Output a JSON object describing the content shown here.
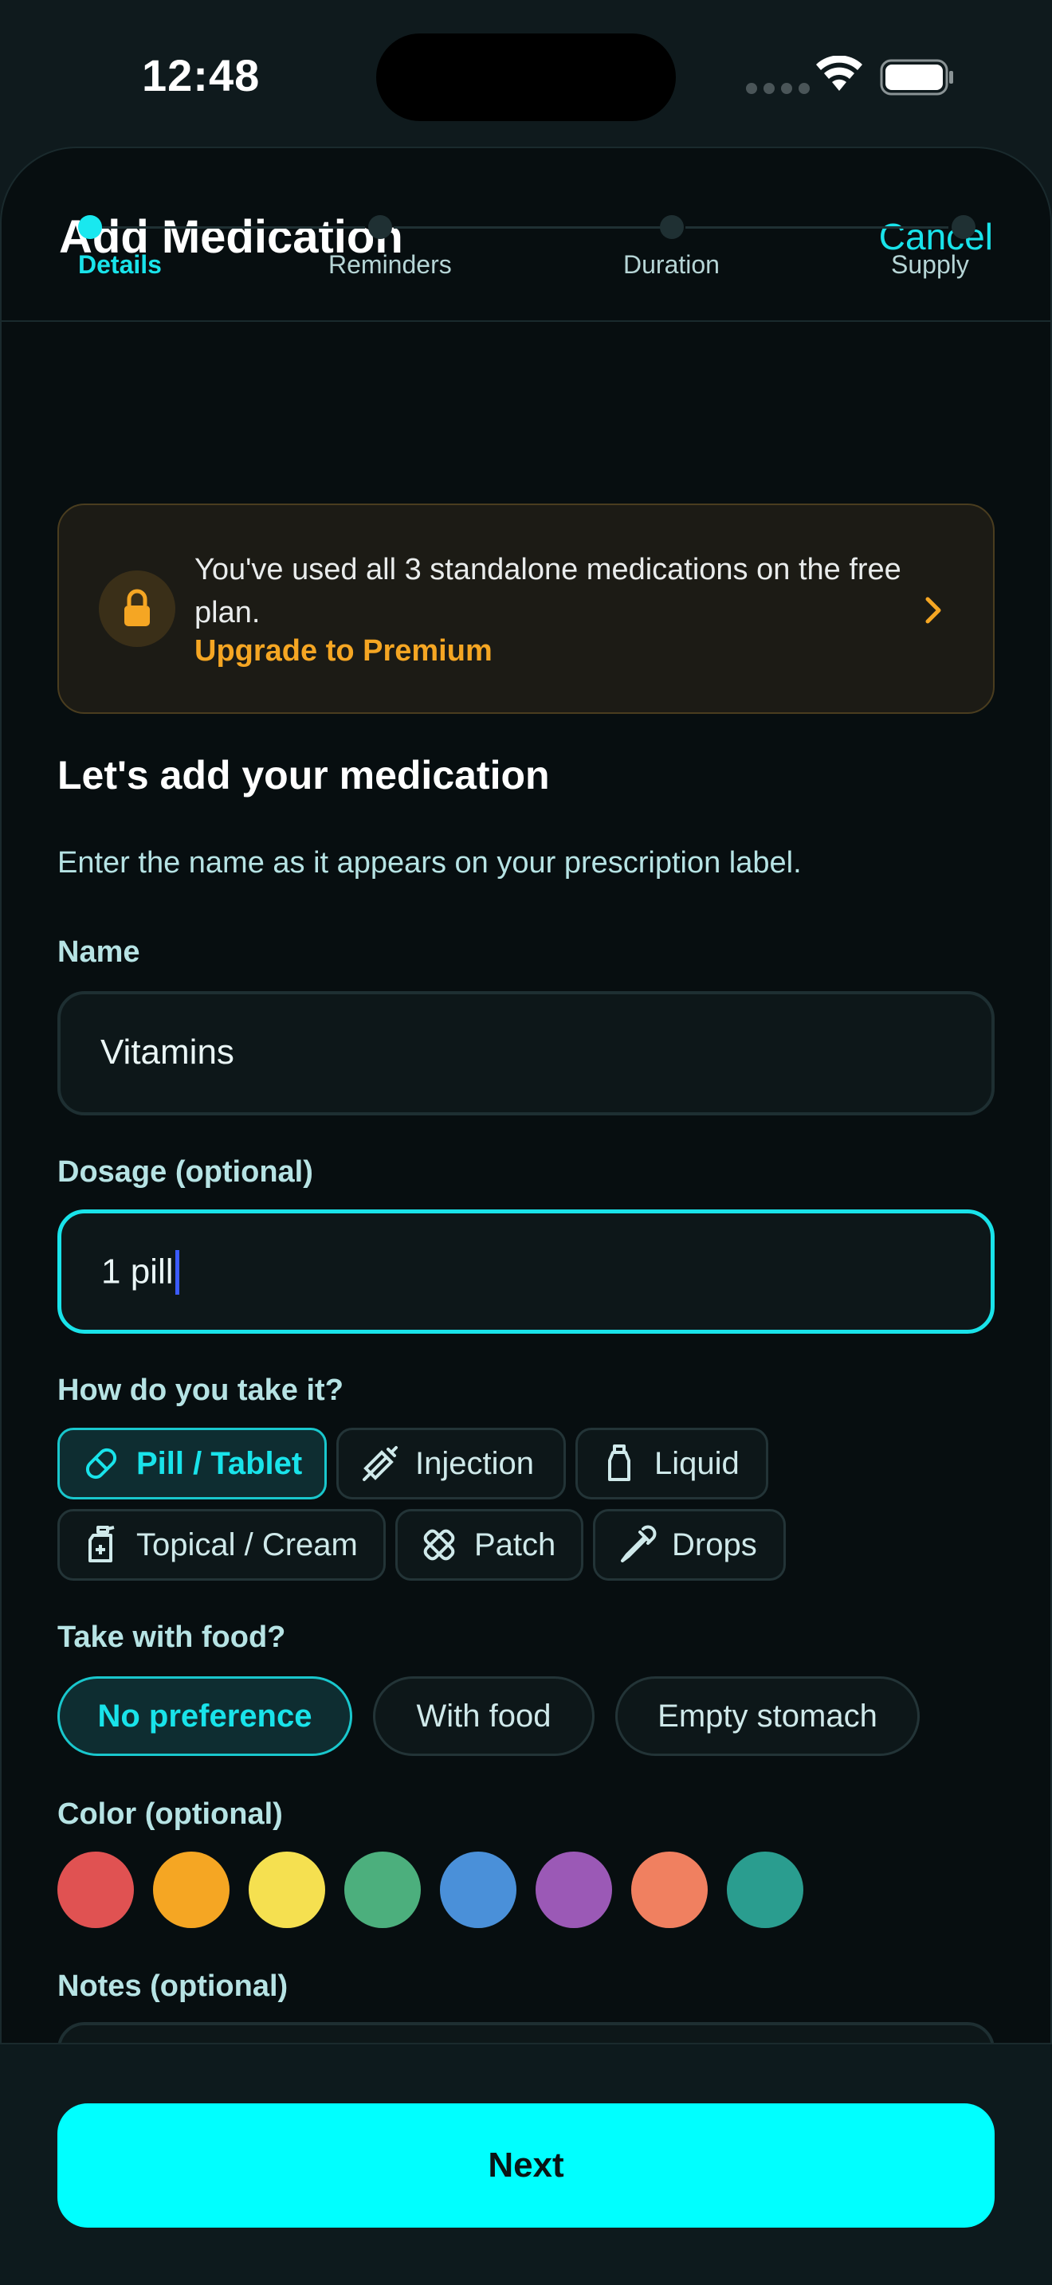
{
  "status_bar": {
    "time": "12:48",
    "icons": [
      "signal-icon",
      "wifi-icon",
      "battery-icon"
    ]
  },
  "header": {
    "title": "Add Medication",
    "cancel_label": "Cancel"
  },
  "stepper": {
    "steps": [
      {
        "label": "Details",
        "active": true
      },
      {
        "label": "Reminders",
        "active": false
      },
      {
        "label": "Duration",
        "active": false
      },
      {
        "label": "Supply",
        "active": false
      }
    ]
  },
  "upgrade_banner": {
    "message": "You've used all 3 standalone medications on the free plan.",
    "link_label": "Upgrade to Premium",
    "icon": "lock-icon"
  },
  "form": {
    "heading": "Let's add your medication",
    "subheading": "Enter the name as it appears on your prescription label.",
    "name": {
      "label": "Name",
      "value": "Vitamins"
    },
    "dosage": {
      "label": "Dosage (optional)",
      "value": "1 pill"
    },
    "method": {
      "label": "How do you take it?",
      "options": [
        {
          "label": "Pill / Tablet",
          "icon": "pill-icon",
          "selected": true
        },
        {
          "label": "Injection",
          "icon": "syringe-icon",
          "selected": false
        },
        {
          "label": "Liquid",
          "icon": "bottle-icon",
          "selected": false
        },
        {
          "label": "Topical / Cream",
          "icon": "cream-bottle-icon",
          "selected": false
        },
        {
          "label": "Patch",
          "icon": "bandage-icon",
          "selected": false
        },
        {
          "label": "Drops",
          "icon": "dropper-icon",
          "selected": false
        }
      ]
    },
    "food": {
      "label": "Take with food?",
      "options": [
        {
          "label": "No preference",
          "selected": true
        },
        {
          "label": "With food",
          "selected": false
        },
        {
          "label": "Empty stomach",
          "selected": false
        }
      ]
    },
    "color": {
      "label": "Color (optional)",
      "swatches": [
        "#e05252",
        "#f5a623",
        "#f5e050",
        "#4caf7d",
        "#4a90d9",
        "#9b59b6",
        "#f08060",
        "#2a9d8f"
      ]
    },
    "notes": {
      "label": "Notes (optional)"
    }
  },
  "footer": {
    "next_label": "Next"
  },
  "colors": {
    "accent": "#00ffff",
    "warning": "#f5a623",
    "background": "#070e10"
  }
}
